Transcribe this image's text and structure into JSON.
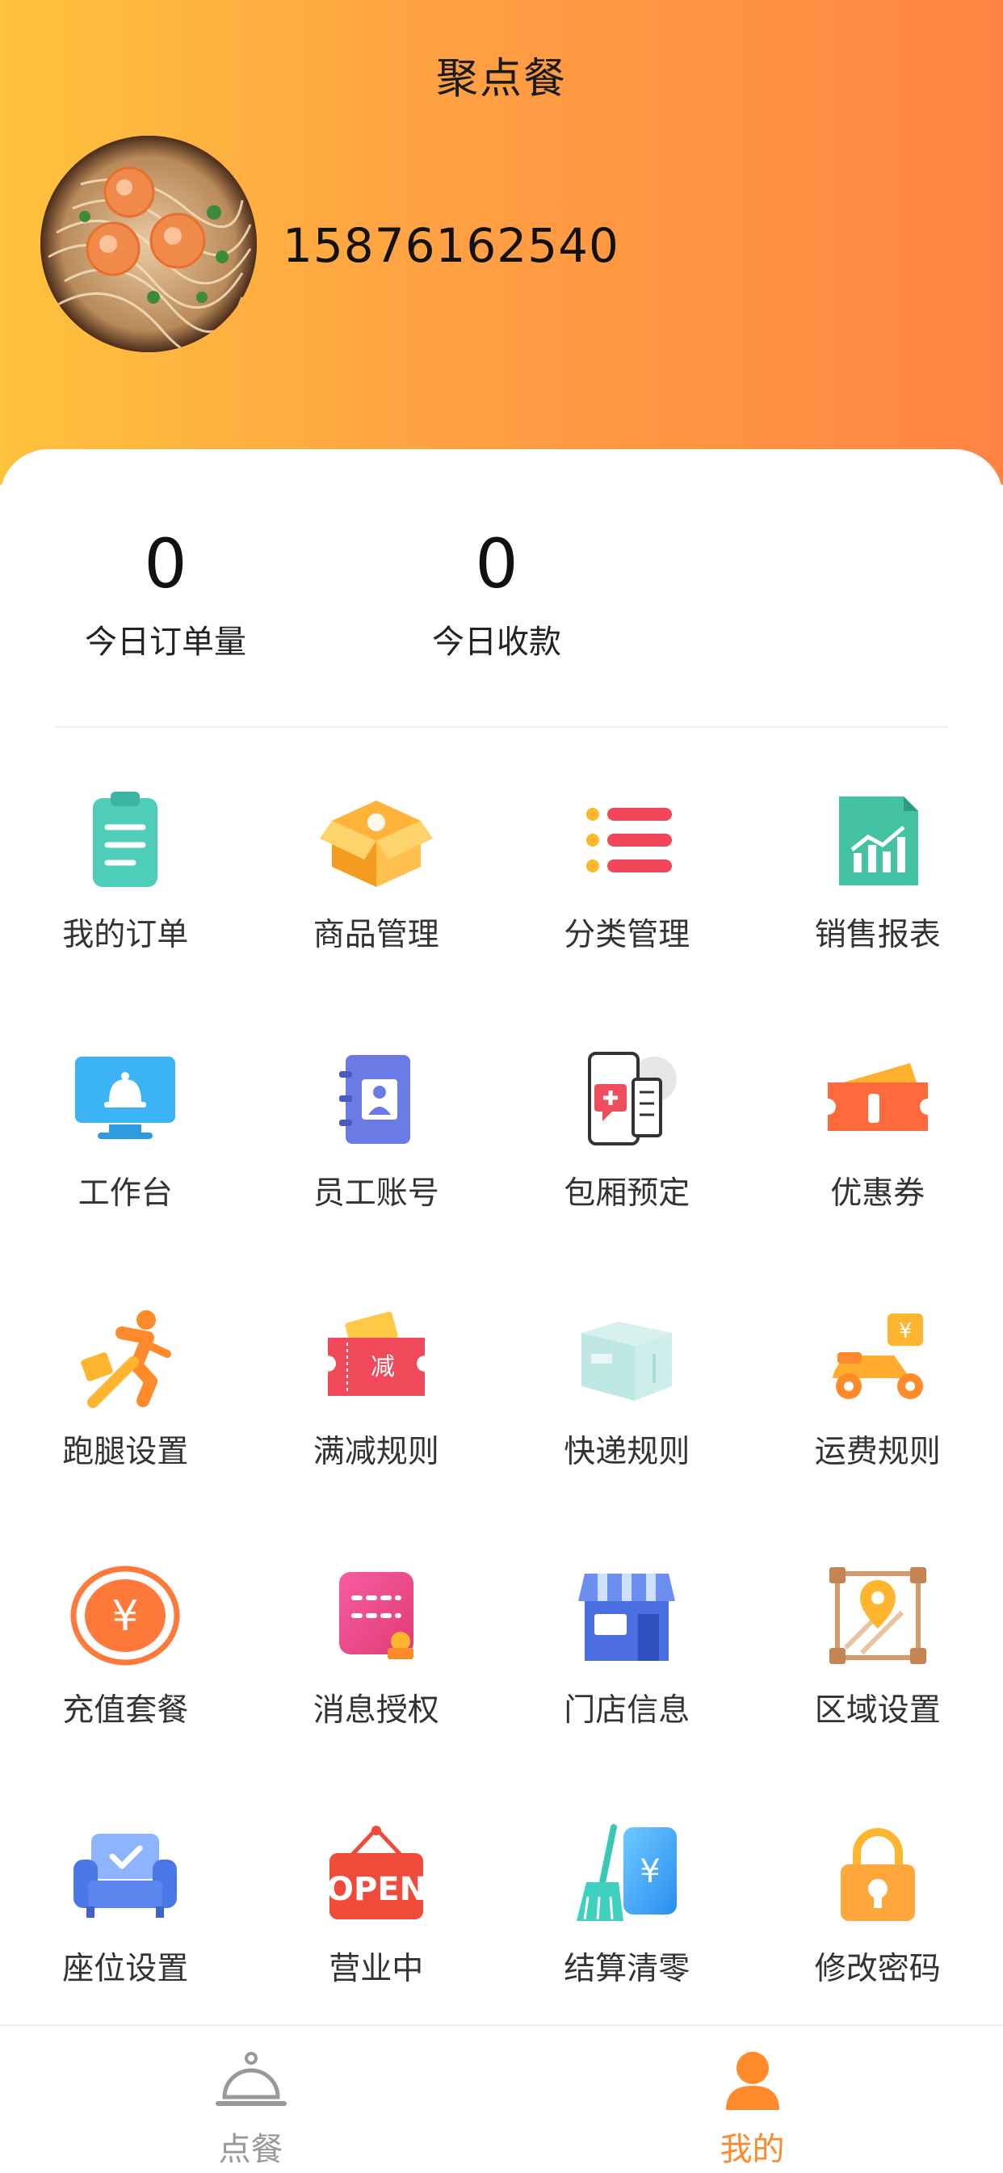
{
  "header": {
    "title": "聚点餐",
    "phone": "15876162540"
  },
  "stats": [
    {
      "value": "0",
      "label": "今日订单量"
    },
    {
      "value": "0",
      "label": "今日收款"
    }
  ],
  "menu": [
    {
      "label": "我的订单",
      "icon": "clipboard-icon"
    },
    {
      "label": "商品管理",
      "icon": "product-box-icon"
    },
    {
      "label": "分类管理",
      "icon": "category-list-icon"
    },
    {
      "label": "销售报表",
      "icon": "sales-report-icon"
    },
    {
      "label": "工作台",
      "icon": "monitor-bell-icon"
    },
    {
      "label": "员工账号",
      "icon": "staff-book-icon"
    },
    {
      "label": "包厢预定",
      "icon": "room-booking-icon"
    },
    {
      "label": "优惠券",
      "icon": "coupon-icon"
    },
    {
      "label": "跑腿设置",
      "icon": "runner-icon"
    },
    {
      "label": "满减规则",
      "icon": "discount-ticket-icon"
    },
    {
      "label": "快递规则",
      "icon": "parcel-icon"
    },
    {
      "label": "运费规则",
      "icon": "scooter-icon"
    },
    {
      "label": "充值套餐",
      "icon": "yuan-coin-icon"
    },
    {
      "label": "消息授权",
      "icon": "message-auth-icon"
    },
    {
      "label": "门店信息",
      "icon": "store-icon"
    },
    {
      "label": "区域设置",
      "icon": "area-map-pin-icon"
    },
    {
      "label": "座位设置",
      "icon": "sofa-icon"
    },
    {
      "label": "营业中",
      "icon": "open-sign-icon"
    },
    {
      "label": "结算清零",
      "icon": "broom-yuan-icon"
    },
    {
      "label": "修改密码",
      "icon": "padlock-icon"
    }
  ],
  "tabbar": {
    "order": {
      "label": "点餐",
      "icon": "cloche-icon",
      "color": "#999999"
    },
    "mine": {
      "label": "我的",
      "icon": "user-icon",
      "color": "#ff8a2b"
    }
  },
  "colors": {
    "accent": "#ff8a2b",
    "header_start": "#ffc23c",
    "header_end": "#ff8443"
  }
}
